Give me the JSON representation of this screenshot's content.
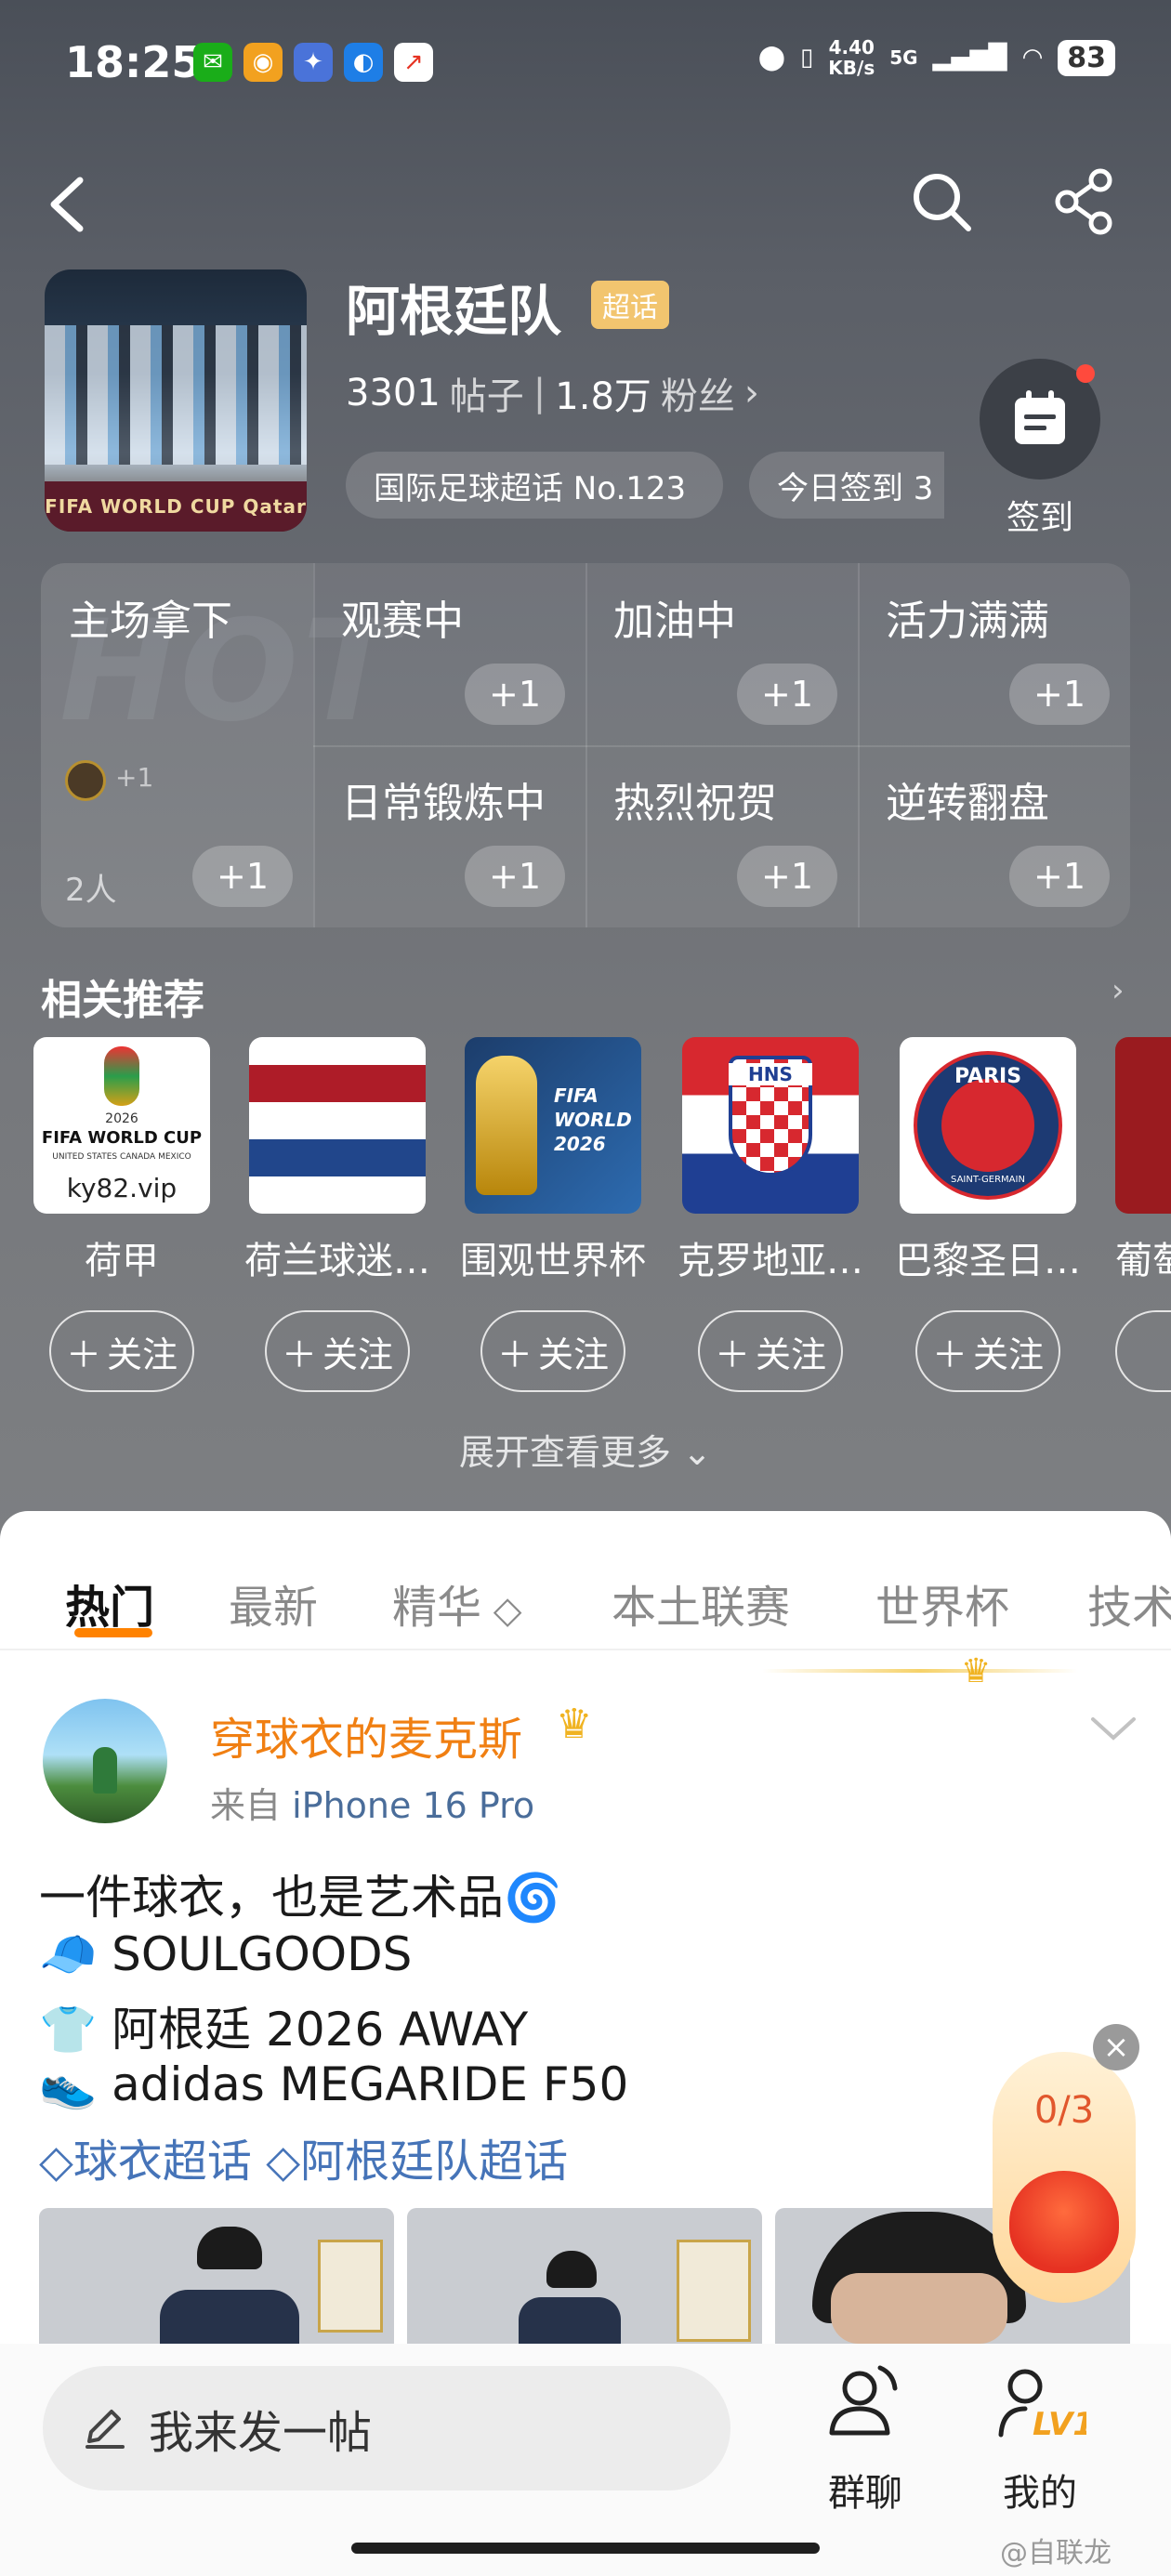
{
  "status_bar": {
    "time": "18:25",
    "net_speed_value": "4.40",
    "net_speed_unit": "KB/s",
    "network": "5G",
    "battery": "83"
  },
  "topic": {
    "name": "阿根廷队",
    "badge": "超话",
    "posts_count": "3301",
    "posts_label": "帖子",
    "fans_count": "1.8万",
    "fans_label": "粉丝",
    "cover_banner": "FIFA WORLD CUP Qatar",
    "tags": [
      "国际足球超话 No.123",
      "今日签到 3"
    ],
    "checkin_label": "签到"
  },
  "cheer": {
    "watermark": "HOT",
    "items": [
      {
        "label": "主场拿下",
        "plus": "+1"
      },
      {
        "label": "观赛中",
        "plus": "+1"
      },
      {
        "label": "加油中",
        "plus": "+1"
      },
      {
        "label": "活力满满",
        "plus": "+1"
      },
      {
        "label": "日常锻炼中",
        "plus": "+1"
      },
      {
        "label": "热烈祝贺",
        "plus": "+1"
      },
      {
        "label": "逆转翻盘",
        "plus": "+1"
      }
    ],
    "first_mini_plus": "+1",
    "first_people": "2人"
  },
  "recommend": {
    "title": "相关推荐",
    "follow_label": "关注",
    "expand_more": "展开查看更多",
    "items": [
      {
        "name": "荷甲",
        "thumb_caption": "ky82.vip",
        "thumb_text": "FIFA WORLD CUP",
        "thumb_sub": "UNITED STATES CANADA MEXICO",
        "thumb_year": "2026"
      },
      {
        "name": "荷兰球迷…"
      },
      {
        "name": "围观世界杯",
        "thumb_text": "FIFA WORLD 2026"
      },
      {
        "name": "克罗地亚…",
        "thumb_text": "HNS"
      },
      {
        "name": "巴黎圣日…",
        "thumb_text": "PARIS",
        "thumb_sub": "SAINT-GERMAIN"
      },
      {
        "name": "葡萄"
      }
    ]
  },
  "tabs": [
    "热门",
    "最新",
    "精华",
    "本土联赛",
    "世界杯",
    "技术"
  ],
  "post": {
    "author": "穿球衣的麦克斯",
    "source_prefix": "来自",
    "source_device": "iPhone 16 Pro",
    "lines": [
      "一件球衣，也是艺术品🌀",
      "🧢 SOULGOODS",
      "👕 阿根廷 2026 AWAY",
      "👟 adidas MEGARIDE F50"
    ],
    "topics": [
      "球衣超话",
      "阿根廷队超话"
    ]
  },
  "redbag": {
    "count": "0/3"
  },
  "bottom": {
    "compose_placeholder": "我来发一帖",
    "group_chat": "群聊",
    "mine": "我的",
    "level": "LV1"
  },
  "watermark": "@自联龙",
  "colors": {
    "accent": "#ff8200",
    "author": "#f07f12",
    "link": "#4674b8",
    "badge": "#f2c56f"
  }
}
